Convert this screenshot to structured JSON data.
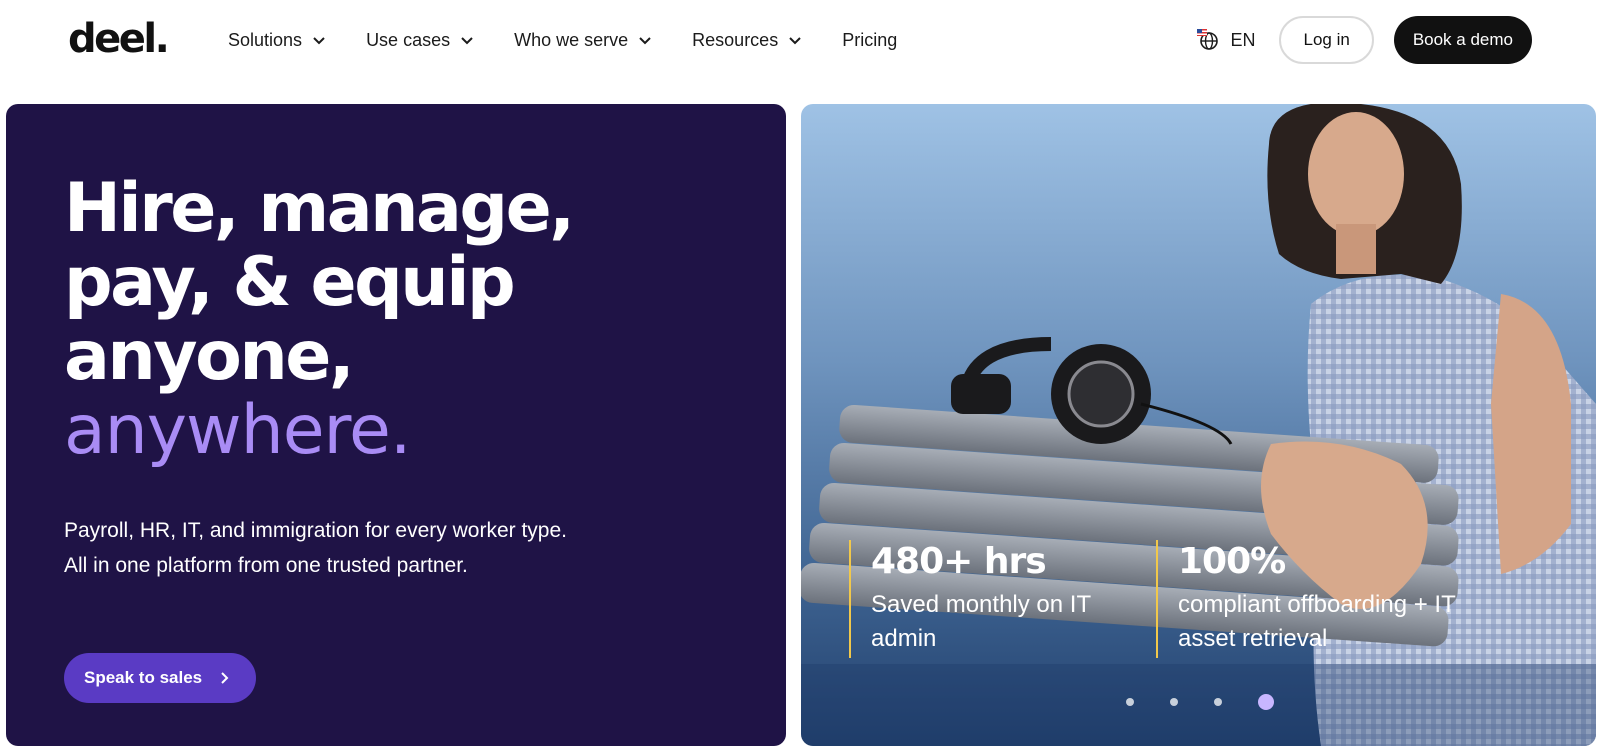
{
  "nav": {
    "logo": "deel.",
    "items": [
      {
        "label": "Solutions",
        "has_dropdown": true
      },
      {
        "label": "Use cases",
        "has_dropdown": true
      },
      {
        "label": "Who we serve",
        "has_dropdown": true
      },
      {
        "label": "Resources",
        "has_dropdown": true
      },
      {
        "label": "Pricing",
        "has_dropdown": false
      }
    ],
    "language": "EN",
    "login_label": "Log in",
    "demo_label": "Book a demo"
  },
  "hero": {
    "headline_lines": [
      "Hire, manage,",
      "pay, & equip",
      "anyone,"
    ],
    "headline_accent": "anywhere.",
    "subtext_lines": [
      "Payroll, HR, IT, and immigration for every worker type.",
      "All in one platform from one trusted partner."
    ],
    "cta_label": "Speak to sales"
  },
  "stats": [
    {
      "value": "480+ hrs",
      "description": "Saved monthly on IT admin"
    },
    {
      "value": "100%",
      "description": "compliant offboarding + IT asset retrieval"
    }
  ],
  "carousel": {
    "count": 4,
    "active_index": 3
  },
  "colors": {
    "hero_bg": "#1f1346",
    "accent_purple": "#a98cf5",
    "cta_purple": "#5a3bc4",
    "stat_border": "#f1c84b",
    "dark_button": "#111111"
  }
}
